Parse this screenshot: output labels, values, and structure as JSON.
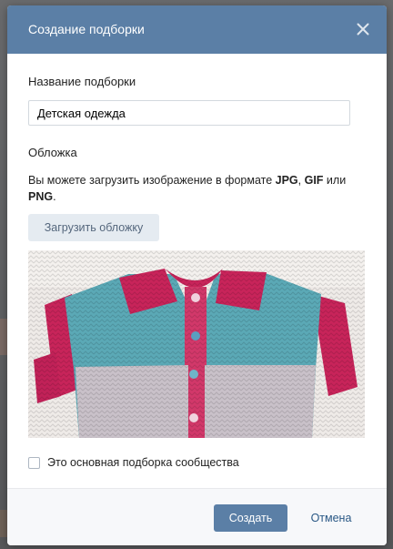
{
  "modal": {
    "title": "Создание подборки",
    "close_icon": "close-icon"
  },
  "form": {
    "name_label": "Название подборки",
    "name_value": "Детская одежда",
    "cover_label": "Обложка",
    "hint_text_before": "Вы можете загрузить изображение в формате ",
    "hint_jpg": "JPG",
    "hint_comma": ", ",
    "hint_gif": "GIF",
    "hint_or": " или ",
    "hint_png": "PNG",
    "hint_end": ".",
    "upload_button": "Загрузить обложку",
    "cover_image": "knitted-baby-cardigan-photo",
    "main_collection_checkbox_label": "Это основная подборка сообщества",
    "main_collection_checked": false
  },
  "footer": {
    "create_button": "Создать",
    "cancel_button": "Отмена"
  },
  "colors": {
    "header": "#5b7fa6",
    "primary_button": "#5b7fa6",
    "secondary_button_bg": "#e5ebf1",
    "link": "#2a5885"
  }
}
